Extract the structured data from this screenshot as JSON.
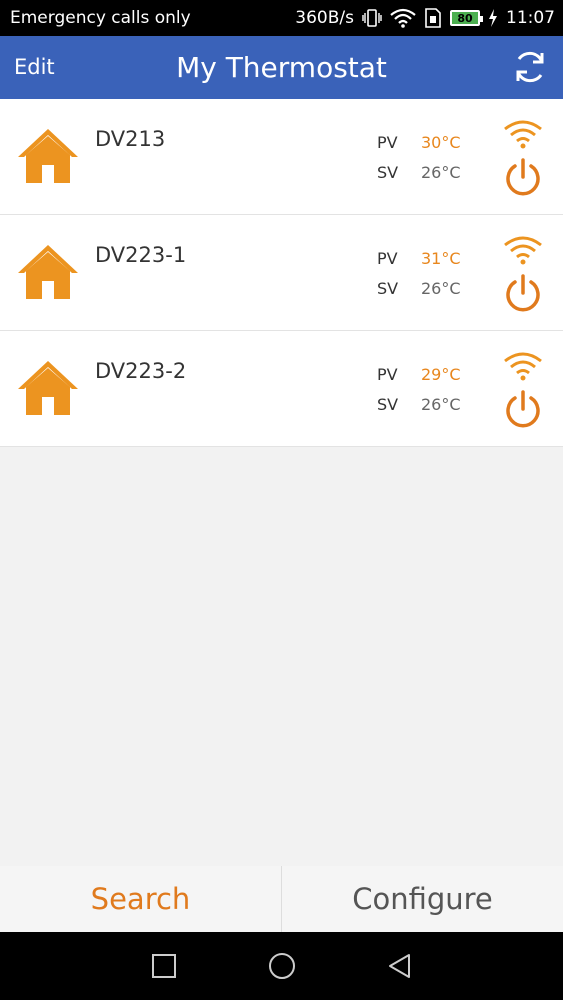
{
  "status_bar": {
    "carrier": "Emergency calls only",
    "speed": "360B/s",
    "battery": "80",
    "time": "11:07"
  },
  "header": {
    "edit_label": "Edit",
    "title": "My Thermostat",
    "refresh_icon": "refresh-icon"
  },
  "devices": [
    {
      "name": "DV213",
      "pv_label": "PV",
      "pv": "30°C",
      "sv_label": "SV",
      "sv": "26°C"
    },
    {
      "name": "DV223-1",
      "pv_label": "PV",
      "pv": "31°C",
      "sv_label": "SV",
      "sv": "26°C"
    },
    {
      "name": "DV223-2",
      "pv_label": "PV",
      "pv": "29°C",
      "sv_label": "SV",
      "sv": "26°C"
    }
  ],
  "tabs": {
    "search": "Search",
    "configure": "Configure"
  },
  "colors": {
    "header": "#3a62b9",
    "accent": "#e8871e",
    "pv": "#e8871e"
  }
}
